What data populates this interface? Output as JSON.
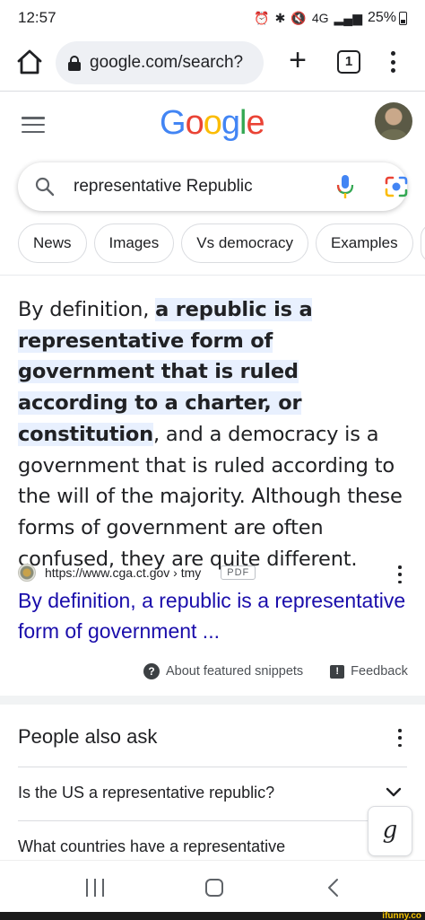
{
  "status_bar": {
    "time": "12:57",
    "network": "4G",
    "battery": "25%"
  },
  "browser": {
    "url": "google.com/search?",
    "tab_count": "1"
  },
  "header": {
    "logo": [
      "G",
      "o",
      "o",
      "g",
      "l",
      "e"
    ],
    "logo_colors": [
      "#4285f4",
      "#ea4335",
      "#fbbc05",
      "#4285f4",
      "#34a853",
      "#ea4335"
    ]
  },
  "search": {
    "query": "representative Republic"
  },
  "chips": [
    "News",
    "Images",
    "Vs democracy",
    "Examples"
  ],
  "featured_snippet": {
    "lead": "By definition, ",
    "highlight": "a republic is a representative form of government that is ruled according to a charter, or constitution",
    "rest": ", and a democracy is a government that is ruled according to the will of the majority. Although these forms of government are often confused, they are quite different.",
    "source_url": "https://www.cga.ct.gov › tmy",
    "badge": "PDF",
    "title": "By definition, a republic is a representative form of government ...",
    "about_label": "About featured snippets",
    "feedback_label": "Feedback"
  },
  "people_also_ask": {
    "title": "People also ask",
    "questions": [
      "Is the US a representative republic?",
      "What countries have a representative"
    ]
  },
  "watermark": "ifunny.co",
  "colors": {
    "link_blue": "#1a0dab",
    "highlight": "#e8f0fe",
    "mic_blue": "#4285f4",
    "text": "#202124"
  }
}
